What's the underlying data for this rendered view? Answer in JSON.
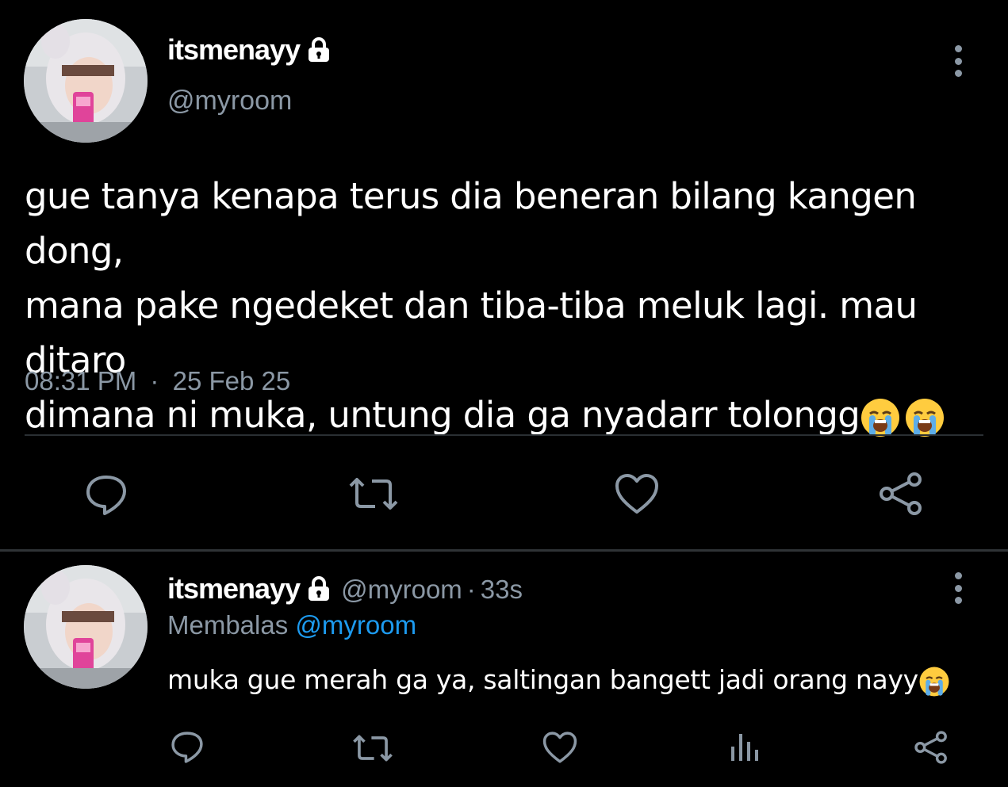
{
  "main_tweet": {
    "display_name": "itsmenayy",
    "handle": "@myroom",
    "text": "gue tanya kenapa terus dia beneran bilang kangen dong,\nmana pake ngedeket dan tiba-tiba meluk lagi. mau ditaro\ndimana ni muka, untung dia ga nyadarr tolongg",
    "time": "08:31 PM",
    "separator": "·",
    "date": "25 Feb 25",
    "emoji_count": 2,
    "icons": [
      "reply-icon",
      "retweet-icon",
      "like-icon",
      "share-icon"
    ]
  },
  "reply_tweet": {
    "display_name": "itsmenayy",
    "handle": "@myroom",
    "separator": "·",
    "time_ago": "33s",
    "replying_prefix": "Membalas",
    "replying_to": "@myroom",
    "text": "muka gue merah ga ya, saltingan bangett jadi orang nayy",
    "emoji_count": 1,
    "icons": [
      "reply-icon",
      "retweet-icon",
      "like-icon",
      "analytics-icon",
      "share-icon"
    ]
  },
  "colors": {
    "background": "#000000",
    "text_primary": "#ffffff",
    "text_secondary": "#8b98a5",
    "link": "#1d9bf0",
    "divider": "#2f3336"
  }
}
